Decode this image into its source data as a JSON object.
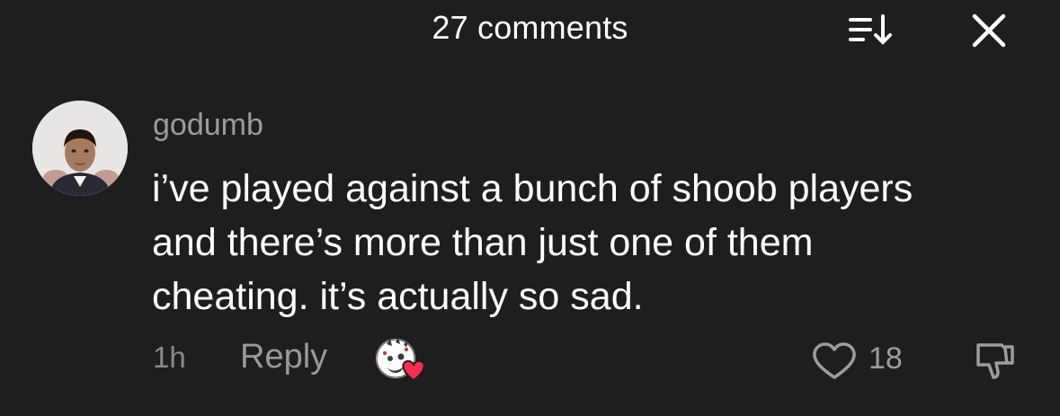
{
  "header": {
    "title": "27 comments",
    "sort_icon": "sort-down-icon",
    "close_icon": "close-icon"
  },
  "comment": {
    "username": "godumb",
    "text_lines": [
      "i’ve played against a bunch of shoob players",
      "and there’s more than just one of them",
      "cheating. it’s actually so sad."
    ],
    "time": "1h",
    "reply_label": "Reply",
    "like_count": "18"
  },
  "colors": {
    "background": "#1e1e1e",
    "primary_text": "#ffffff",
    "secondary_text": "#9c9c9c",
    "heart_red": "#fe2c55"
  }
}
